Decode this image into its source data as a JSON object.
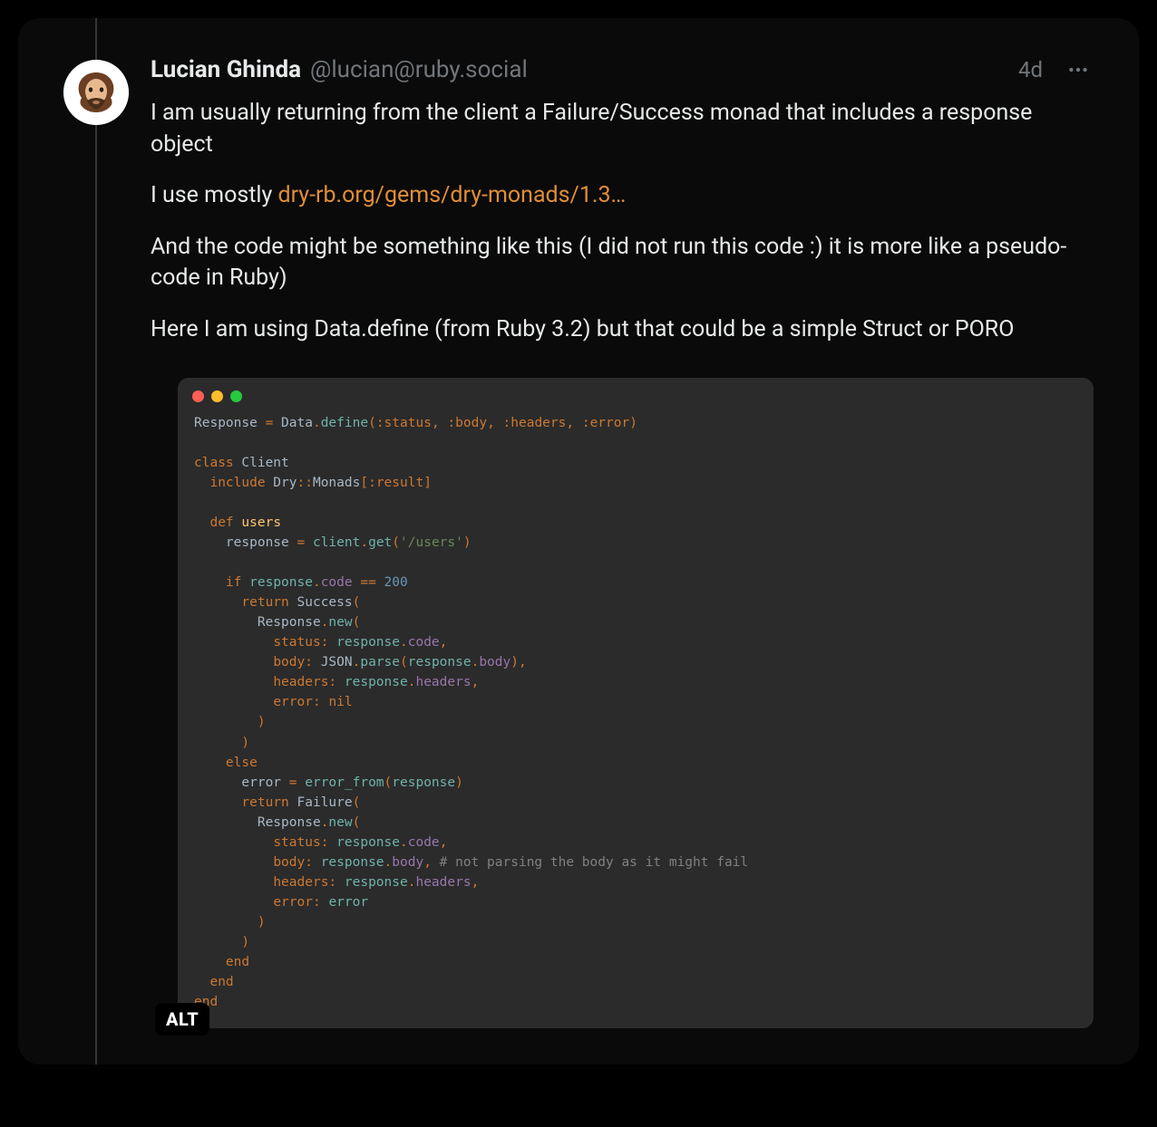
{
  "post": {
    "author": {
      "display_name": "Lucian Ghinda",
      "handle": "@lucian@ruby.social"
    },
    "timestamp": "4d",
    "body": {
      "p1": "I am usually returning from the client a Failure/Success monad that includes a response object",
      "p2_prefix": "I use mostly ",
      "p2_link": "dry-rb.org/gems/dry-monads/1.3…",
      "p3": "And the code might be something like this (I did not run this code :) it is more like a pseudo-code in Ruby)",
      "p4": "Here I am using Data.define (from Ruby 3.2) but that could be a simple Struct or PORO"
    },
    "alt_badge": "ALT",
    "code": {
      "l1_a": "Response ",
      "l1_b": "=",
      "l1_c": " Data",
      "l1_d": ".",
      "l1_e": "define",
      "l1_f": "(",
      "l1_g": ":status",
      "l1_h": ", ",
      "l1_i": ":body",
      "l1_j": ", ",
      "l1_k": ":headers",
      "l1_l": ", ",
      "l1_m": ":error",
      "l1_n": ")",
      "l3_a": "class",
      "l3_b": " Client",
      "l4_a": "  ",
      "l4_b": "include",
      "l4_c": " Dry",
      "l4_d": "::",
      "l4_e": "Monads",
      "l4_f": "[",
      "l4_g": ":result",
      "l4_h": "]",
      "l6_a": "  ",
      "l6_b": "def",
      "l6_c": " ",
      "l6_d": "users",
      "l7_a": "    response ",
      "l7_b": "=",
      "l7_c": " ",
      "l7_d": "client",
      "l7_e": ".",
      "l7_f": "get",
      "l7_g": "(",
      "l7_h": "'/users'",
      "l7_i": ")",
      "l9_a": "    ",
      "l9_b": "if",
      "l9_c": " ",
      "l9_d": "response",
      "l9_e": ".",
      "l9_f": "code",
      "l9_g": " == ",
      "l9_h": "200",
      "l10_a": "      ",
      "l10_b": "return",
      "l10_c": " Success",
      "l10_d": "(",
      "l11_a": "        Response",
      "l11_b": ".",
      "l11_c": "new",
      "l11_d": "(",
      "l12_a": "          ",
      "l12_b": "status:",
      "l12_c": " ",
      "l12_d": "response",
      "l12_e": ".",
      "l12_f": "code",
      "l12_g": ",",
      "l13_a": "          ",
      "l13_b": "body:",
      "l13_c": " JSON",
      "l13_d": ".",
      "l13_e": "parse",
      "l13_f": "(",
      "l13_g": "response",
      "l13_h": ".",
      "l13_i": "body",
      "l13_j": ")",
      "l13_k": ",",
      "l14_a": "          ",
      "l14_b": "headers:",
      "l14_c": " ",
      "l14_d": "response",
      "l14_e": ".",
      "l14_f": "headers",
      "l14_g": ",",
      "l15_a": "          ",
      "l15_b": "error:",
      "l15_c": " ",
      "l15_d": "nil",
      "l16": "        )",
      "l17": "      )",
      "l18_a": "    ",
      "l18_b": "else",
      "l19_a": "      error ",
      "l19_b": "=",
      "l19_c": " ",
      "l19_d": "error_from",
      "l19_e": "(",
      "l19_f": "response",
      "l19_g": ")",
      "l20_a": "      ",
      "l20_b": "return",
      "l20_c": " Failure",
      "l20_d": "(",
      "l21_a": "        Response",
      "l21_b": ".",
      "l21_c": "new",
      "l21_d": "(",
      "l22_a": "          ",
      "l22_b": "status:",
      "l22_c": " ",
      "l22_d": "response",
      "l22_e": ".",
      "l22_f": "code",
      "l22_g": ",",
      "l23_a": "          ",
      "l23_b": "body:",
      "l23_c": " ",
      "l23_d": "response",
      "l23_e": ".",
      "l23_f": "body",
      "l23_g": ", ",
      "l23_h": "# not parsing the body as it might fail",
      "l24_a": "          ",
      "l24_b": "headers:",
      "l24_c": " ",
      "l24_d": "response",
      "l24_e": ".",
      "l24_f": "headers",
      "l24_g": ",",
      "l25_a": "          ",
      "l25_b": "error:",
      "l25_c": " ",
      "l25_d": "error",
      "l26": "        )",
      "l27": "      )",
      "l28_a": "    ",
      "l28_b": "end",
      "l29_a": "  ",
      "l29_b": "end",
      "l30": "end"
    }
  }
}
